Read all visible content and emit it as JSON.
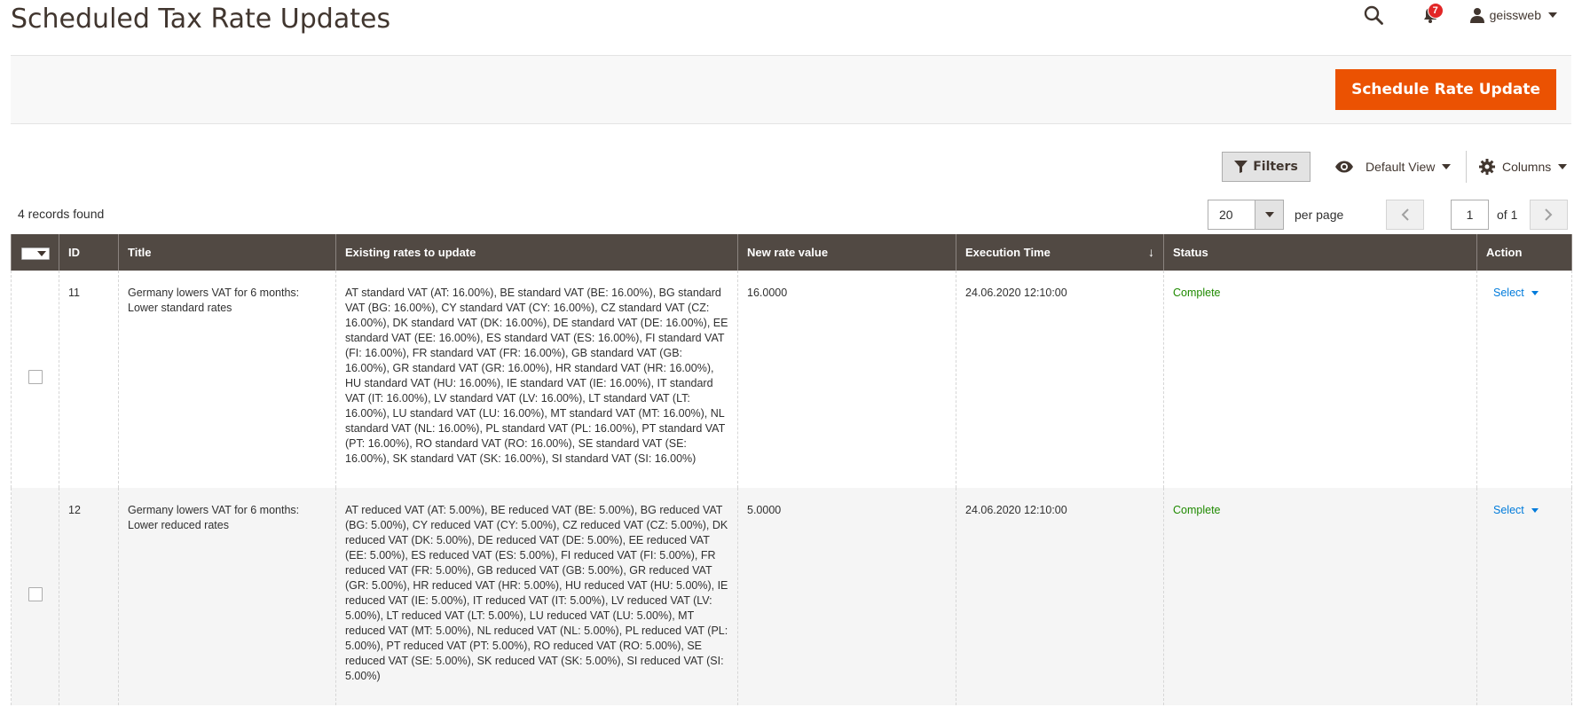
{
  "header": {
    "title": "Scheduled Tax Rate Updates",
    "notification_count": "7",
    "username": "geissweb",
    "icons": [
      "search-icon",
      "bell-icon",
      "user-icon"
    ]
  },
  "action_bar": {
    "primary_button_label": "Schedule Rate Update",
    "accent_color": "#eb5202"
  },
  "grid_controls": {
    "filters_label": "Filters",
    "view_label": "Default View",
    "columns_label": "Columns",
    "records_found": "4 records found",
    "per_page_value": "20",
    "per_page_label": "per page",
    "current_page": "1",
    "total_pages_label": "of 1"
  },
  "table": {
    "columns": {
      "id": "ID",
      "title": "Title",
      "existing": "Existing rates to update",
      "new_rate": "New rate value",
      "execution": "Execution Time",
      "status": "Status",
      "action": "Action"
    },
    "sort_indicator": "↓",
    "header_color": "#514943",
    "rows": [
      {
        "id": "11",
        "title": "Germany lowers VAT for 6 months: Lower standard rates",
        "existing": "AT standard VAT (AT: 16.00%), BE standard VAT (BE: 16.00%), BG standard VAT (BG: 16.00%), CY standard VAT (CY: 16.00%), CZ standard VAT (CZ: 16.00%), DK standard VAT (DK: 16.00%), DE standard VAT (DE: 16.00%), EE standard VAT (EE: 16.00%), ES standard VAT (ES: 16.00%), FI standard VAT (FI: 16.00%), FR standard VAT (FR: 16.00%), GB standard VAT (GB: 16.00%), GR standard VAT (GR: 16.00%), HR standard VAT (HR: 16.00%), HU standard VAT (HU: 16.00%), IE standard VAT (IE: 16.00%), IT standard VAT (IT: 16.00%), LV standard VAT (LV: 16.00%), LT standard VAT (LT: 16.00%), LU standard VAT (LU: 16.00%), MT standard VAT (MT: 16.00%), NL standard VAT (NL: 16.00%), PL standard VAT (PL: 16.00%), PT standard VAT (PT: 16.00%), RO standard VAT (RO: 16.00%), SE standard VAT (SE: 16.00%), SK standard VAT (SK: 16.00%), SI standard VAT (SI: 16.00%)",
        "new_rate": "16.0000",
        "execution": "24.06.2020 12:10:00",
        "status": "Complete",
        "action": "Select"
      },
      {
        "id": "12",
        "title": "Germany lowers VAT for 6 months: Lower reduced rates",
        "existing": "AT reduced VAT (AT: 5.00%), BE reduced VAT (BE: 5.00%), BG reduced VAT (BG: 5.00%), CY reduced VAT (CY: 5.00%), CZ reduced VAT (CZ: 5.00%), DK reduced VAT (DK: 5.00%), DE reduced VAT (DE: 5.00%), EE reduced VAT (EE: 5.00%), ES reduced VAT (ES: 5.00%), FI reduced VAT (FI: 5.00%), FR reduced VAT (FR: 5.00%), GB reduced VAT (GB: 5.00%), GR reduced VAT (GR: 5.00%), HR reduced VAT (HR: 5.00%), HU reduced VAT (HU: 5.00%), IE reduced VAT (IE: 5.00%), IT reduced VAT (IT: 5.00%), LV reduced VAT (LV: 5.00%), LT reduced VAT (LT: 5.00%), LU reduced VAT (LU: 5.00%), MT reduced VAT (MT: 5.00%), NL reduced VAT (NL: 5.00%), PL reduced VAT (PL: 5.00%), PT reduced VAT (PT: 5.00%), RO reduced VAT (RO: 5.00%), SE reduced VAT (SE: 5.00%), SK reduced VAT (SK: 5.00%), SI reduced VAT (SI: 5.00%)",
        "new_rate": "5.0000",
        "execution": "24.06.2020 12:10:00",
        "status": "Complete",
        "action": "Select"
      }
    ]
  }
}
